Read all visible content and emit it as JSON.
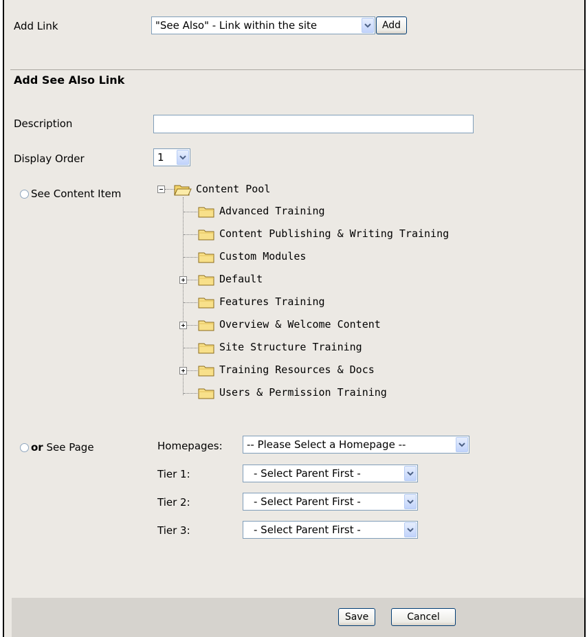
{
  "add_link": {
    "label": "Add Link",
    "type_select_value": "\"See Also\" - Link within the site",
    "add_button": "Add"
  },
  "section_title": "Add See Also Link",
  "description": {
    "label": "Description",
    "value": ""
  },
  "display_order": {
    "label": "Display Order",
    "value": "1"
  },
  "content_item": {
    "radio_label": "See Content Item",
    "tree": {
      "root": "Content Pool",
      "children": [
        {
          "label": "Advanced Training",
          "expandable": false
        },
        {
          "label": "Content Publishing & Writing Training",
          "expandable": false
        },
        {
          "label": "Custom Modules",
          "expandable": false
        },
        {
          "label": "Default",
          "expandable": true
        },
        {
          "label": "Features Training",
          "expandable": false
        },
        {
          "label": "Overview & Welcome Content",
          "expandable": true
        },
        {
          "label": "Site Structure Training",
          "expandable": false
        },
        {
          "label": "Training Resources & Docs",
          "expandable": true
        },
        {
          "label": "Users & Permission Training",
          "expandable": false
        }
      ]
    }
  },
  "see_page": {
    "radio_prefix": "or",
    "radio_label": "See Page",
    "homepages_label": "Homepages:",
    "homepages_value": "-- Please Select a Homepage --",
    "tiers": [
      {
        "label": "Tier 1:",
        "value": "- Select Parent First -"
      },
      {
        "label": "Tier 2:",
        "value": "- Select Parent First -"
      },
      {
        "label": "Tier 3:",
        "value": "- Select Parent First -"
      }
    ]
  },
  "footer": {
    "save": "Save",
    "cancel": "Cancel"
  },
  "icons": {
    "dropdown": "chevron-down-icon",
    "folder": "folder-icon",
    "open_folder": "open-folder-icon",
    "collapse": "tree-collapse-icon",
    "expand": "tree-expand-icon"
  },
  "colors": {
    "panel_bg": "#ECE9E4",
    "footer_bg": "#D6D3CE",
    "folder": "#F8E08A",
    "select_arrow": "#C1D3FB",
    "input_border": "#7F9DB9"
  }
}
